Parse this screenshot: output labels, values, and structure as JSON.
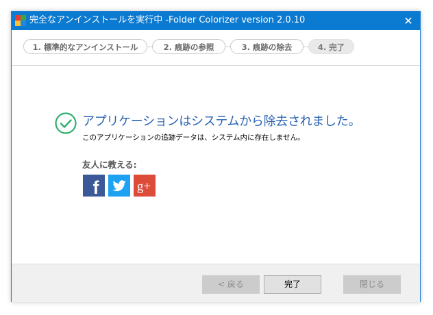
{
  "window": {
    "title": "完全なアンインストールを実行中 -Folder Colorizer version 2.0.10",
    "close_glyph": "✕"
  },
  "steps": [
    {
      "label": "1. 標準的なアンインストール"
    },
    {
      "label": "2. 痕跡の参照"
    },
    {
      "label": "3. 痕跡の除去"
    },
    {
      "label": "4. 完了",
      "active": true
    }
  ],
  "main": {
    "headline": "アプリケーションはシステムから除去されました。",
    "subline": "このアプリケーションの追跡データは、システム内に存在しません。",
    "share_label": "友人に教える:"
  },
  "social": [
    {
      "name": "facebook-icon",
      "glyph": "f",
      "color": "#3b5998"
    },
    {
      "name": "twitter-icon",
      "color": "#1da1f2"
    },
    {
      "name": "google-plus-icon",
      "glyph": "g+",
      "color": "#dd4b39"
    }
  ],
  "footer": {
    "back_label": "< 戻る",
    "finish_label": "完了",
    "close_label": "閉じる"
  },
  "colors": {
    "titlebar": "#0b7ad1",
    "check": "#2fae6e",
    "headline": "#2c64b4"
  }
}
